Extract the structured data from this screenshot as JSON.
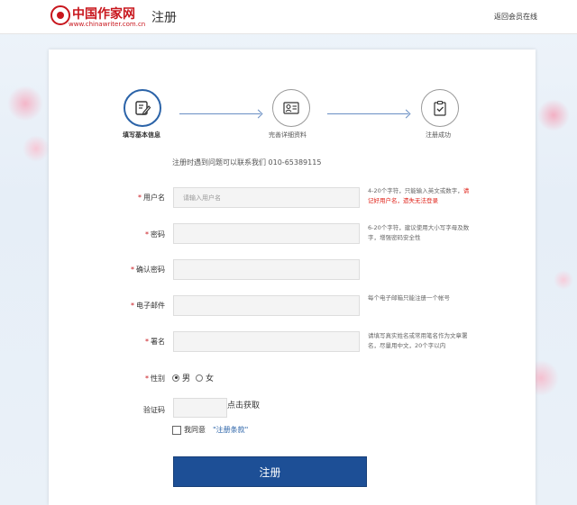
{
  "header": {
    "logo_cn": "中国作家网",
    "logo_en": "www.chinawriter.com.cn",
    "title": "注册",
    "back_link": "返回会员在线"
  },
  "steps": [
    {
      "label": "填写基本信息",
      "icon": "edit-icon",
      "active": true
    },
    {
      "label": "完善详细资料",
      "icon": "profile-card-icon",
      "active": false
    },
    {
      "label": "注册成功",
      "icon": "clipboard-check-icon",
      "active": false
    }
  ],
  "help_text": "注册时遇到问题可以联系我们 010-65389115",
  "form": {
    "username": {
      "required_mark": "*",
      "label": "用户名",
      "placeholder": "请输入用户名",
      "value": "",
      "hint": "4-20个字符，只能输入英文或数字，",
      "hint_warn": "请记好用户名，遗失无法登录"
    },
    "password": {
      "required_mark": "*",
      "label": "密码",
      "value": "",
      "hint": "6-20个字符，建议使用大小写字母及数字，增强密码安全性"
    },
    "confirm_password": {
      "required_mark": "*",
      "label": "确认密码",
      "value": ""
    },
    "email": {
      "required_mark": "*",
      "label": "电子邮件",
      "value": "",
      "hint": "每个电子邮箱只能注册一个帐号"
    },
    "pen_name": {
      "required_mark": "*",
      "label": "署名",
      "value": "",
      "hint": "请填写真实姓名或常用笔名作为文章署名，尽量用中文，20个字以内"
    },
    "gender": {
      "required_mark": "*",
      "label": "性别",
      "options": [
        "男",
        "女"
      ],
      "selected": "男"
    },
    "captcha": {
      "label": "验证码",
      "value": "",
      "get_link": "点击获取"
    },
    "agree": {
      "label": "我同意",
      "terms": "\"注册条款\"",
      "checked": false
    },
    "submit_label": "注册"
  }
}
